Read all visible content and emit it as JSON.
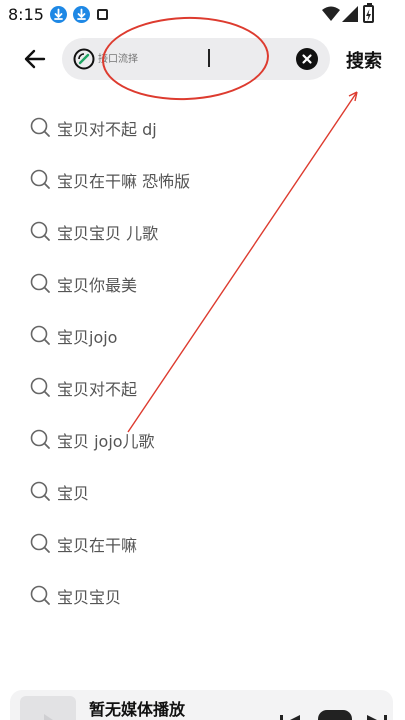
{
  "status_bar": {
    "time": "8:15",
    "icons": [
      "download-icon",
      "download-icon",
      "square-icon",
      "wifi-icon",
      "signal-icon",
      "battery-icon"
    ]
  },
  "header": {
    "back_icon": "arrow-left-icon",
    "search": {
      "value": "",
      "placeholder": "接口流择",
      "clear_icon": "clear-icon"
    },
    "search_button_label": "搜索"
  },
  "suggestions": [
    {
      "label": "宝贝对不起 dj"
    },
    {
      "label": "宝贝在干嘛 恐怖版"
    },
    {
      "label": "宝贝宝贝 儿歌"
    },
    {
      "label": "宝贝你最美"
    },
    {
      "label": "宝贝jojo"
    },
    {
      "label": "宝贝对不起"
    },
    {
      "label": "宝贝 jojo儿歌"
    },
    {
      "label": "宝贝"
    },
    {
      "label": "宝贝在干嘛"
    },
    {
      "label": "宝贝宝贝"
    }
  ],
  "player": {
    "title": "暂无媒体播放",
    "icons": [
      "previous-icon",
      "play-icon",
      "next-icon"
    ]
  },
  "colors": {
    "accent_download": "#1e88e5",
    "annotation": "#dd3b2f",
    "search_bg": "#ececee",
    "text_secondary": "#555555"
  }
}
